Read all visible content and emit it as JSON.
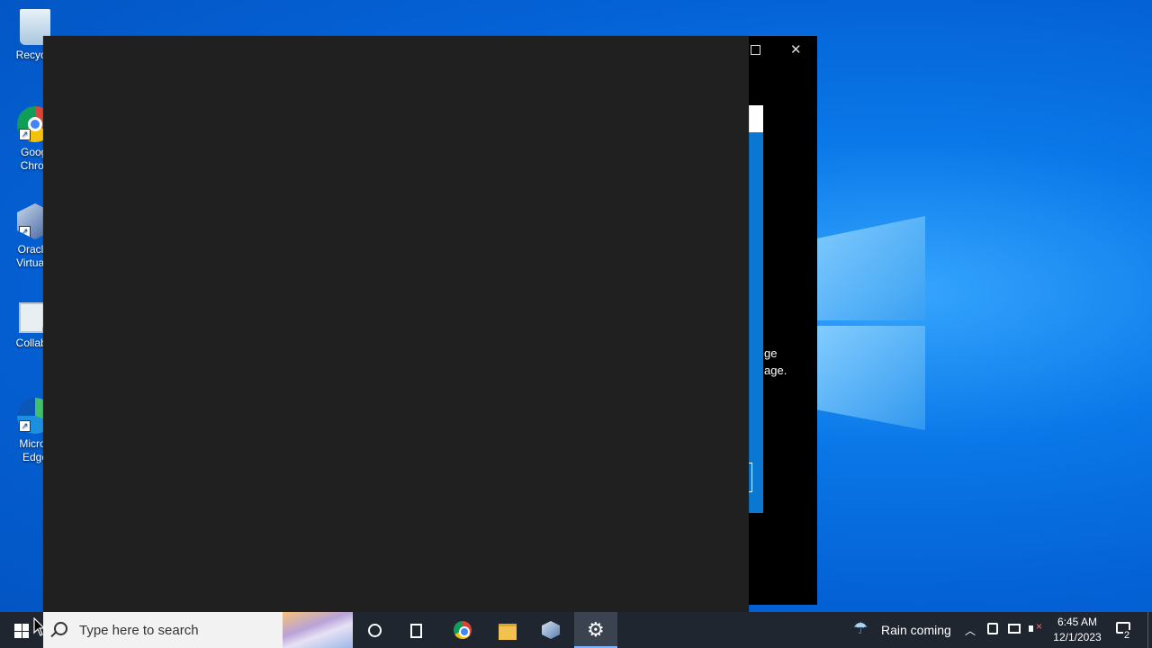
{
  "desktop": {
    "icons": [
      {
        "label": "Recycle",
        "name": "recycle-bin-icon"
      },
      {
        "label": "Googl\nChron",
        "name": "google-chrome-icon"
      },
      {
        "label": "Oracle \nVirtualE",
        "name": "virtualbox-icon"
      },
      {
        "label": "CollabN",
        "name": "collab-icon"
      },
      {
        "label": "Micros\nEdge",
        "name": "edge-icon"
      }
    ]
  },
  "back_window": {
    "partial_text": "ge\nage."
  },
  "taskbar": {
    "search_placeholder": "Type here to search",
    "weather_text": "Rain coming",
    "clock_time": "6:45 AM",
    "clock_date": "12/1/2023",
    "notification_count": "2",
    "pinned": [
      "cortana-icon",
      "task-view-icon",
      "chrome-icon",
      "file-explorer-icon",
      "virtualbox-icon",
      "settings-icon"
    ]
  },
  "colors": {
    "taskbar_bg": "#1f2630",
    "front_window_bg": "#202020",
    "accent": "#0a78d2"
  }
}
